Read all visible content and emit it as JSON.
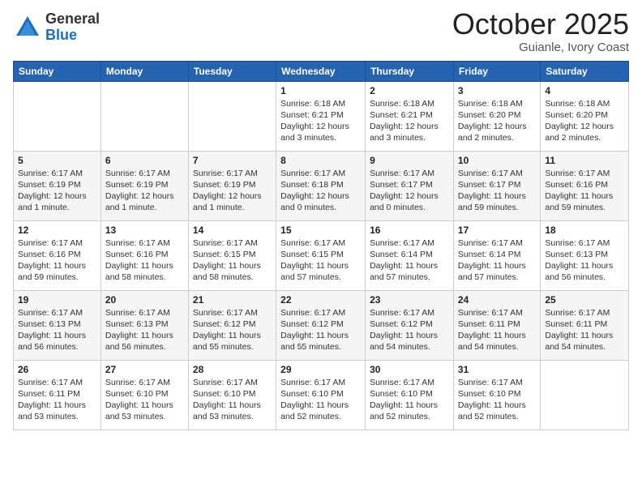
{
  "header": {
    "logo_general": "General",
    "logo_blue": "Blue",
    "month": "October 2025",
    "location": "Guianle, Ivory Coast"
  },
  "weekdays": [
    "Sunday",
    "Monday",
    "Tuesday",
    "Wednesday",
    "Thursday",
    "Friday",
    "Saturday"
  ],
  "weeks": [
    [
      {
        "day": "",
        "info": ""
      },
      {
        "day": "",
        "info": ""
      },
      {
        "day": "",
        "info": ""
      },
      {
        "day": "1",
        "info": "Sunrise: 6:18 AM\nSunset: 6:21 PM\nDaylight: 12 hours and 3 minutes."
      },
      {
        "day": "2",
        "info": "Sunrise: 6:18 AM\nSunset: 6:21 PM\nDaylight: 12 hours and 3 minutes."
      },
      {
        "day": "3",
        "info": "Sunrise: 6:18 AM\nSunset: 6:20 PM\nDaylight: 12 hours and 2 minutes."
      },
      {
        "day": "4",
        "info": "Sunrise: 6:18 AM\nSunset: 6:20 PM\nDaylight: 12 hours and 2 minutes."
      }
    ],
    [
      {
        "day": "5",
        "info": "Sunrise: 6:17 AM\nSunset: 6:19 PM\nDaylight: 12 hours and 1 minute."
      },
      {
        "day": "6",
        "info": "Sunrise: 6:17 AM\nSunset: 6:19 PM\nDaylight: 12 hours and 1 minute."
      },
      {
        "day": "7",
        "info": "Sunrise: 6:17 AM\nSunset: 6:19 PM\nDaylight: 12 hours and 1 minute."
      },
      {
        "day": "8",
        "info": "Sunrise: 6:17 AM\nSunset: 6:18 PM\nDaylight: 12 hours and 0 minutes."
      },
      {
        "day": "9",
        "info": "Sunrise: 6:17 AM\nSunset: 6:17 PM\nDaylight: 12 hours and 0 minutes."
      },
      {
        "day": "10",
        "info": "Sunrise: 6:17 AM\nSunset: 6:17 PM\nDaylight: 11 hours and 59 minutes."
      },
      {
        "day": "11",
        "info": "Sunrise: 6:17 AM\nSunset: 6:16 PM\nDaylight: 11 hours and 59 minutes."
      }
    ],
    [
      {
        "day": "12",
        "info": "Sunrise: 6:17 AM\nSunset: 6:16 PM\nDaylight: 11 hours and 59 minutes."
      },
      {
        "day": "13",
        "info": "Sunrise: 6:17 AM\nSunset: 6:16 PM\nDaylight: 11 hours and 58 minutes."
      },
      {
        "day": "14",
        "info": "Sunrise: 6:17 AM\nSunset: 6:15 PM\nDaylight: 11 hours and 58 minutes."
      },
      {
        "day": "15",
        "info": "Sunrise: 6:17 AM\nSunset: 6:15 PM\nDaylight: 11 hours and 57 minutes."
      },
      {
        "day": "16",
        "info": "Sunrise: 6:17 AM\nSunset: 6:14 PM\nDaylight: 11 hours and 57 minutes."
      },
      {
        "day": "17",
        "info": "Sunrise: 6:17 AM\nSunset: 6:14 PM\nDaylight: 11 hours and 57 minutes."
      },
      {
        "day": "18",
        "info": "Sunrise: 6:17 AM\nSunset: 6:13 PM\nDaylight: 11 hours and 56 minutes."
      }
    ],
    [
      {
        "day": "19",
        "info": "Sunrise: 6:17 AM\nSunset: 6:13 PM\nDaylight: 11 hours and 56 minutes."
      },
      {
        "day": "20",
        "info": "Sunrise: 6:17 AM\nSunset: 6:13 PM\nDaylight: 11 hours and 56 minutes."
      },
      {
        "day": "21",
        "info": "Sunrise: 6:17 AM\nSunset: 6:12 PM\nDaylight: 11 hours and 55 minutes."
      },
      {
        "day": "22",
        "info": "Sunrise: 6:17 AM\nSunset: 6:12 PM\nDaylight: 11 hours and 55 minutes."
      },
      {
        "day": "23",
        "info": "Sunrise: 6:17 AM\nSunset: 6:12 PM\nDaylight: 11 hours and 54 minutes."
      },
      {
        "day": "24",
        "info": "Sunrise: 6:17 AM\nSunset: 6:11 PM\nDaylight: 11 hours and 54 minutes."
      },
      {
        "day": "25",
        "info": "Sunrise: 6:17 AM\nSunset: 6:11 PM\nDaylight: 11 hours and 54 minutes."
      }
    ],
    [
      {
        "day": "26",
        "info": "Sunrise: 6:17 AM\nSunset: 6:11 PM\nDaylight: 11 hours and 53 minutes."
      },
      {
        "day": "27",
        "info": "Sunrise: 6:17 AM\nSunset: 6:10 PM\nDaylight: 11 hours and 53 minutes."
      },
      {
        "day": "28",
        "info": "Sunrise: 6:17 AM\nSunset: 6:10 PM\nDaylight: 11 hours and 53 minutes."
      },
      {
        "day": "29",
        "info": "Sunrise: 6:17 AM\nSunset: 6:10 PM\nDaylight: 11 hours and 52 minutes."
      },
      {
        "day": "30",
        "info": "Sunrise: 6:17 AM\nSunset: 6:10 PM\nDaylight: 11 hours and 52 minutes."
      },
      {
        "day": "31",
        "info": "Sunrise: 6:17 AM\nSunset: 6:10 PM\nDaylight: 11 hours and 52 minutes."
      },
      {
        "day": "",
        "info": ""
      }
    ]
  ]
}
